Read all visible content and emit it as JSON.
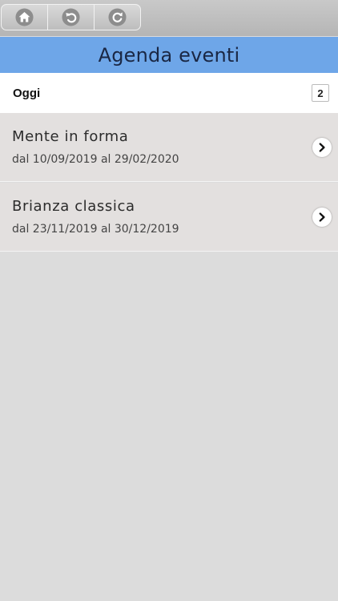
{
  "toolbar": {
    "buttons": [
      {
        "icon": "home-icon"
      },
      {
        "icon": "undo-icon"
      },
      {
        "icon": "refresh-icon"
      }
    ]
  },
  "header": {
    "title": "Agenda eventi",
    "bg_color": "#6ea6e8"
  },
  "today": {
    "label": "Oggi",
    "count": "2"
  },
  "events": [
    {
      "title": "Mente in forma",
      "dates": "dal 10/09/2019 al 29/02/2020",
      "icon": "chevron-right-icon"
    },
    {
      "title": "Brianza classica",
      "dates": "dal 23/11/2019 al 30/12/2019",
      "icon": "chevron-right-icon"
    }
  ]
}
